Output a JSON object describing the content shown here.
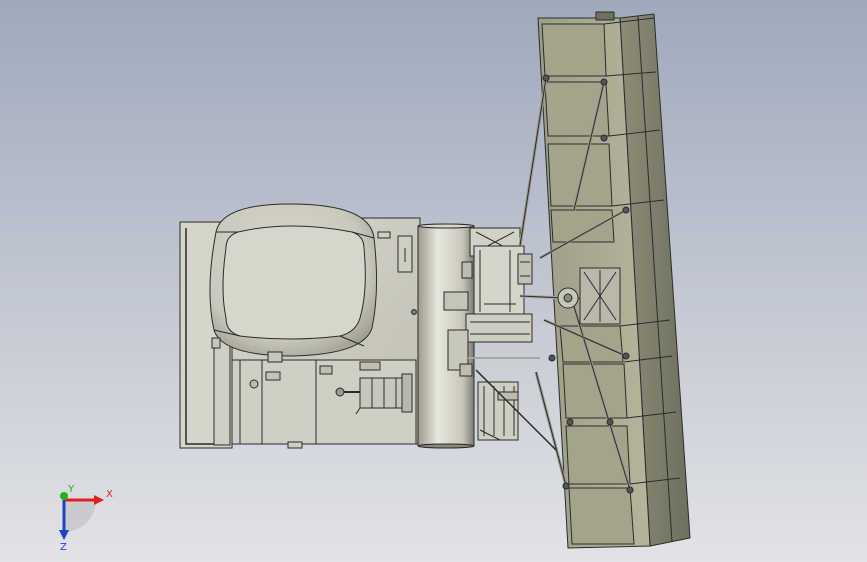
{
  "viewport": {
    "background_top": "#9fa9bc",
    "background_bottom": "#e2e3e7"
  },
  "model": {
    "body_color": "#d3d2c6",
    "panel_color": "#a6a68f",
    "edge_color": "#2b2b2b"
  },
  "triad": {
    "x_label": "X",
    "y_label": "Y",
    "z_label": "Z",
    "x_color": "#e02020",
    "y_color": "#20b020",
    "z_color": "#2040d0"
  }
}
